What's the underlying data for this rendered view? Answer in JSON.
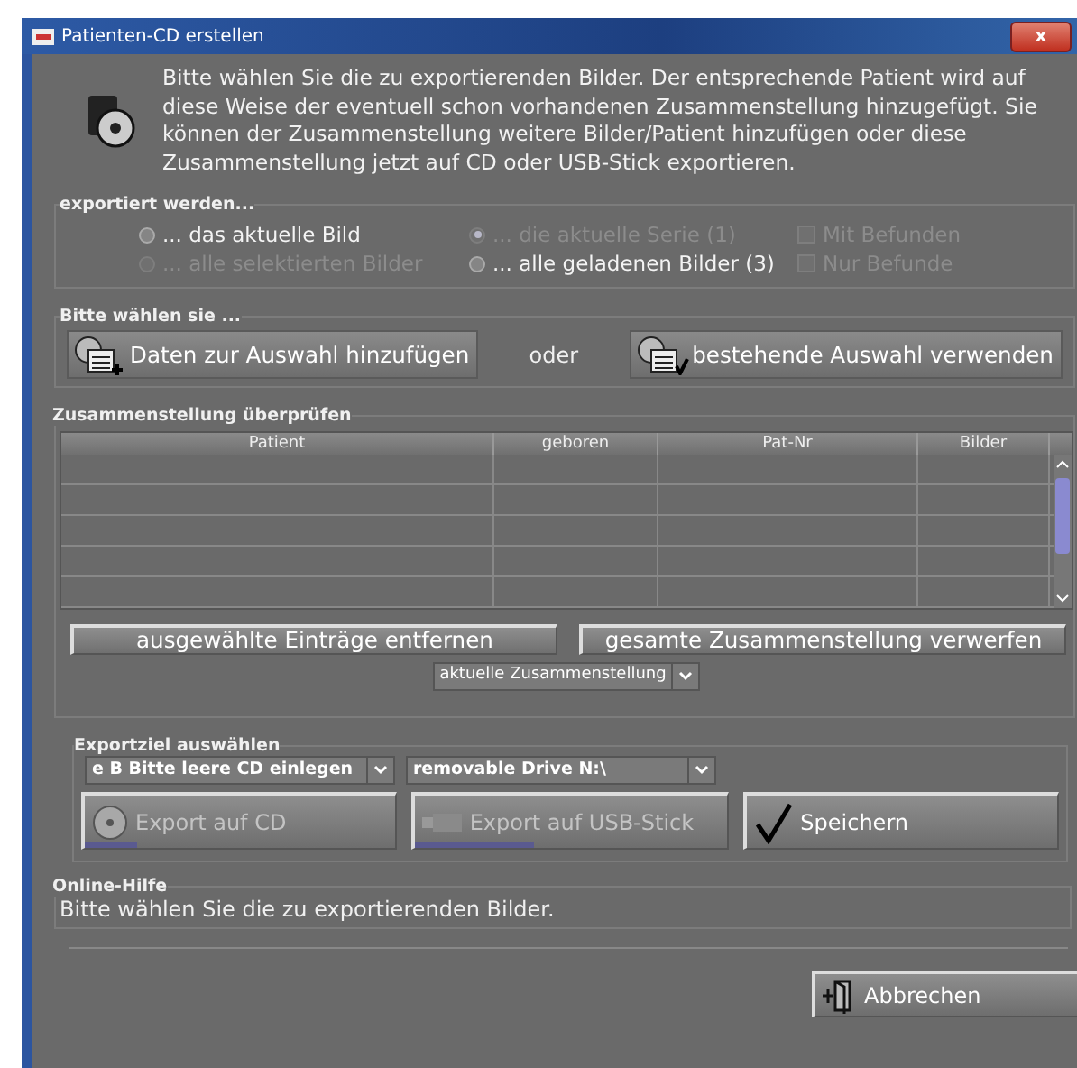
{
  "window": {
    "title": "Patienten-CD erstellen",
    "close": "x"
  },
  "intro": "Bitte wählen Sie die zu exportierenden Bilder. Der entsprechende Patient wird auf diese Weise der eventuell schon vorhandenen Zusammenstellung hinzugefügt. Sie können der Zusammenstellung weitere Bilder/Patient hinzufügen oder diese Zusammenstellung jetzt auf CD oder USB-Stick exportieren.",
  "export_group": {
    "title": "exportiert werden...",
    "options": [
      {
        "kind": "radio",
        "label": "... das aktuelle Bild",
        "selected": false,
        "disabled": false
      },
      {
        "kind": "radio",
        "label": "... die aktuelle Serie (1)",
        "selected": true,
        "disabled": true
      },
      {
        "kind": "checkbox",
        "label": "Mit Befunden",
        "checked": false,
        "disabled": true
      },
      {
        "kind": "radio",
        "label": "... alle selektierten Bilder",
        "selected": false,
        "disabled": true
      },
      {
        "kind": "radio",
        "label": "... alle geladenen Bilder (3)",
        "selected": false,
        "disabled": false
      },
      {
        "kind": "checkbox",
        "label": "Nur Befunde",
        "checked": false,
        "disabled": true
      }
    ]
  },
  "choose_group": {
    "title": "Bitte wählen sie ...",
    "add_button": "Daten zur Auswahl hinzufügen",
    "or": "oder",
    "use_button": "bestehende Auswahl verwenden"
  },
  "review_group": {
    "title": "Zusammenstellung überprüfen",
    "table": {
      "columns": [
        "Patient",
        "geboren",
        "Pat-Nr",
        "Bilder"
      ]
    },
    "remove_button": "ausgewählte Einträge entfernen",
    "discard_button": "gesamte Zusammenstellung verwerfen",
    "view_select": "aktuelle Zusammenstellung"
  },
  "target_group": {
    "title": "Exportziel auswählen",
    "cd_select": "e B Bitte leere CD einlegen",
    "usb_select": "removable Drive N:\\",
    "buttons": [
      {
        "kind": "cd",
        "label": "Export auf CD",
        "disabled": true,
        "level": 0.17
      },
      {
        "kind": "usb",
        "label": "Export auf USB-Stick",
        "disabled": true,
        "level": 0.38
      },
      {
        "kind": "save",
        "label": "Speichern",
        "disabled": false
      }
    ]
  },
  "help": {
    "title": "Online-Hilfe",
    "text": "Bitte wählen Sie die zu exportierenden Bilder."
  },
  "cancel_button": "Abbrechen"
}
